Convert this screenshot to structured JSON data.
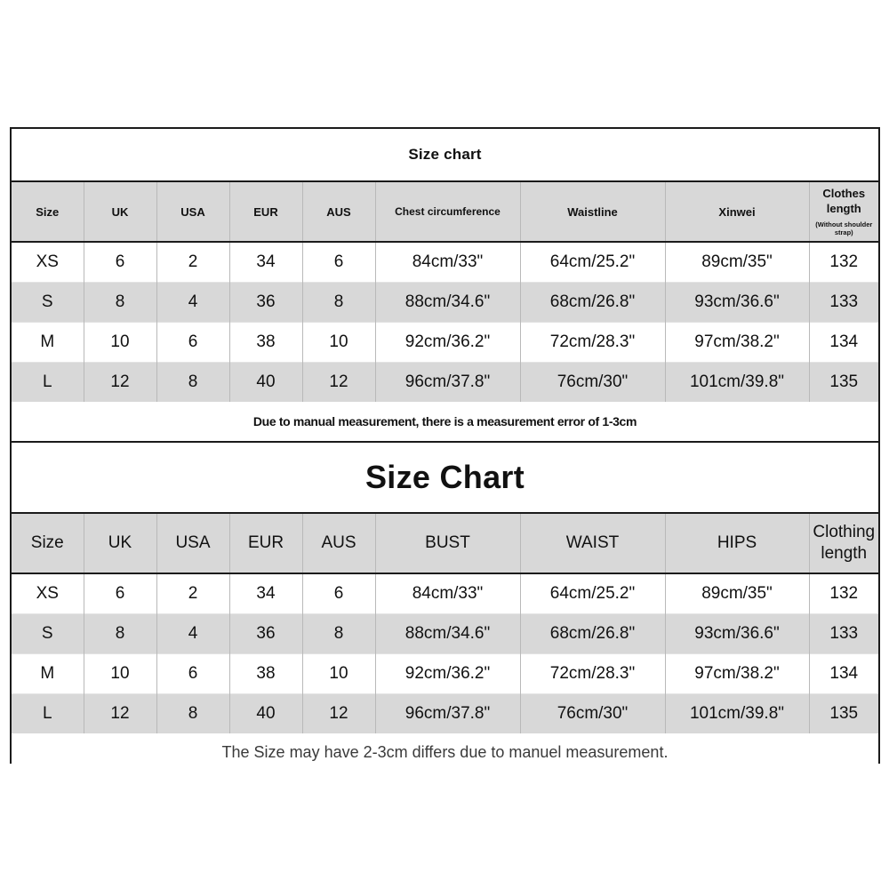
{
  "chart_data": {
    "type": "table",
    "title": "Size chart",
    "tables": [
      {
        "id": "table-a",
        "title": "Size chart",
        "columns": [
          "Size",
          "UK",
          "USA",
          "EUR",
          "AUS",
          "Chest circumference",
          "Waistline",
          "Xinwei",
          "Clothes length"
        ],
        "column_sublabels": {
          "clothes_length": "(Without shoulder strap)"
        },
        "rows": [
          [
            "XS",
            "6",
            "2",
            "34",
            "6",
            "84cm/33\"",
            "64cm/25.2\"",
            "89cm/35\"",
            "132"
          ],
          [
            "S",
            "8",
            "4",
            "36",
            "8",
            "88cm/34.6\"",
            "68cm/26.8\"",
            "93cm/36.6\"",
            "133"
          ],
          [
            "M",
            "10",
            "6",
            "38",
            "10",
            "92cm/36.2\"",
            "72cm/28.3\"",
            "97cm/38.2\"",
            "134"
          ],
          [
            "L",
            "12",
            "8",
            "40",
            "12",
            "96cm/37.8\"",
            "76cm/30\"",
            "101cm/39.8\"",
            "135"
          ]
        ],
        "note": "Due to manual measurement, there is a measurement error of 1-3cm"
      },
      {
        "id": "table-b",
        "title": "Size Chart",
        "columns": [
          "Size",
          "UK",
          "USA",
          "EUR",
          "AUS",
          "BUST",
          "WAIST",
          "HIPS",
          "Clothing length"
        ],
        "rows": [
          [
            "XS",
            "6",
            "2",
            "34",
            "6",
            "84cm/33\"",
            "64cm/25.2\"",
            "89cm/35\"",
            "132"
          ],
          [
            "S",
            "8",
            "4",
            "36",
            "8",
            "88cm/34.6\"",
            "68cm/26.8\"",
            "93cm/36.6\"",
            "133"
          ],
          [
            "M",
            "10",
            "6",
            "38",
            "10",
            "92cm/36.2\"",
            "72cm/28.3\"",
            "97cm/38.2\"",
            "134"
          ],
          [
            "L",
            "12",
            "8",
            "40",
            "12",
            "96cm/37.8\"",
            "76cm/30\"",
            "101cm/39.8\"",
            "135"
          ]
        ],
        "note": "The Size may have 2-3cm differs due to manuel measurement."
      }
    ],
    "colors": {
      "header_fill": "#d8d8d8",
      "alt_row_fill": "#d8d8d8",
      "row_fill": "#ffffff",
      "border": "#1b1b1b",
      "text": "#111111",
      "note_b_text": "#3a3a3a"
    }
  },
  "table_a": {
    "title": "Size chart",
    "headers": {
      "size": "Size",
      "uk": "UK",
      "usa": "USA",
      "eur": "EUR",
      "aus": "AUS",
      "chest": "Chest circumference",
      "waistline": "Waistline",
      "xinwei": "Xinwei",
      "clothes_length": "Clothes length",
      "clothes_length_sub": "(Without shoulder strap)"
    },
    "rows": [
      {
        "size": "XS",
        "uk": "6",
        "usa": "2",
        "eur": "34",
        "aus": "6",
        "chest": "84cm/33\"",
        "waistline": "64cm/25.2\"",
        "xinwei": "89cm/35\"",
        "length": "132"
      },
      {
        "size": "S",
        "uk": "8",
        "usa": "4",
        "eur": "36",
        "aus": "8",
        "chest": "88cm/34.6\"",
        "waistline": "68cm/26.8\"",
        "xinwei": "93cm/36.6\"",
        "length": "133"
      },
      {
        "size": "M",
        "uk": "10",
        "usa": "6",
        "eur": "38",
        "aus": "10",
        "chest": "92cm/36.2\"",
        "waistline": "72cm/28.3\"",
        "xinwei": "97cm/38.2\"",
        "length": "134"
      },
      {
        "size": "L",
        "uk": "12",
        "usa": "8",
        "eur": "40",
        "aus": "12",
        "chest": "96cm/37.8\"",
        "waistline": "76cm/30\"",
        "xinwei": "101cm/39.8\"",
        "length": "135"
      }
    ],
    "note": "Due to manual measurement, there is a measurement error of 1-3cm"
  },
  "table_b": {
    "title": "Size Chart",
    "headers": {
      "size": "Size",
      "uk": "UK",
      "usa": "USA",
      "eur": "EUR",
      "aus": "AUS",
      "bust": "BUST",
      "waist": "WAIST",
      "hips": "HIPS",
      "clothing_length": "Clothing length"
    },
    "rows": [
      {
        "size": "XS",
        "uk": "6",
        "usa": "2",
        "eur": "34",
        "aus": "6",
        "bust": "84cm/33\"",
        "waist": "64cm/25.2\"",
        "hips": "89cm/35\"",
        "length": "132"
      },
      {
        "size": "S",
        "uk": "8",
        "usa": "4",
        "eur": "36",
        "aus": "8",
        "bust": "88cm/34.6\"",
        "waist": "68cm/26.8\"",
        "hips": "93cm/36.6\"",
        "length": "133"
      },
      {
        "size": "M",
        "uk": "10",
        "usa": "6",
        "eur": "38",
        "aus": "10",
        "bust": "92cm/36.2\"",
        "waist": "72cm/28.3\"",
        "hips": "97cm/38.2\"",
        "length": "134"
      },
      {
        "size": "L",
        "uk": "12",
        "usa": "8",
        "eur": "40",
        "aus": "12",
        "bust": "96cm/37.8\"",
        "waist": "76cm/30\"",
        "hips": "101cm/39.8\"",
        "length": "135"
      }
    ],
    "note": "The Size may have 2-3cm differs due to manuel measurement."
  }
}
